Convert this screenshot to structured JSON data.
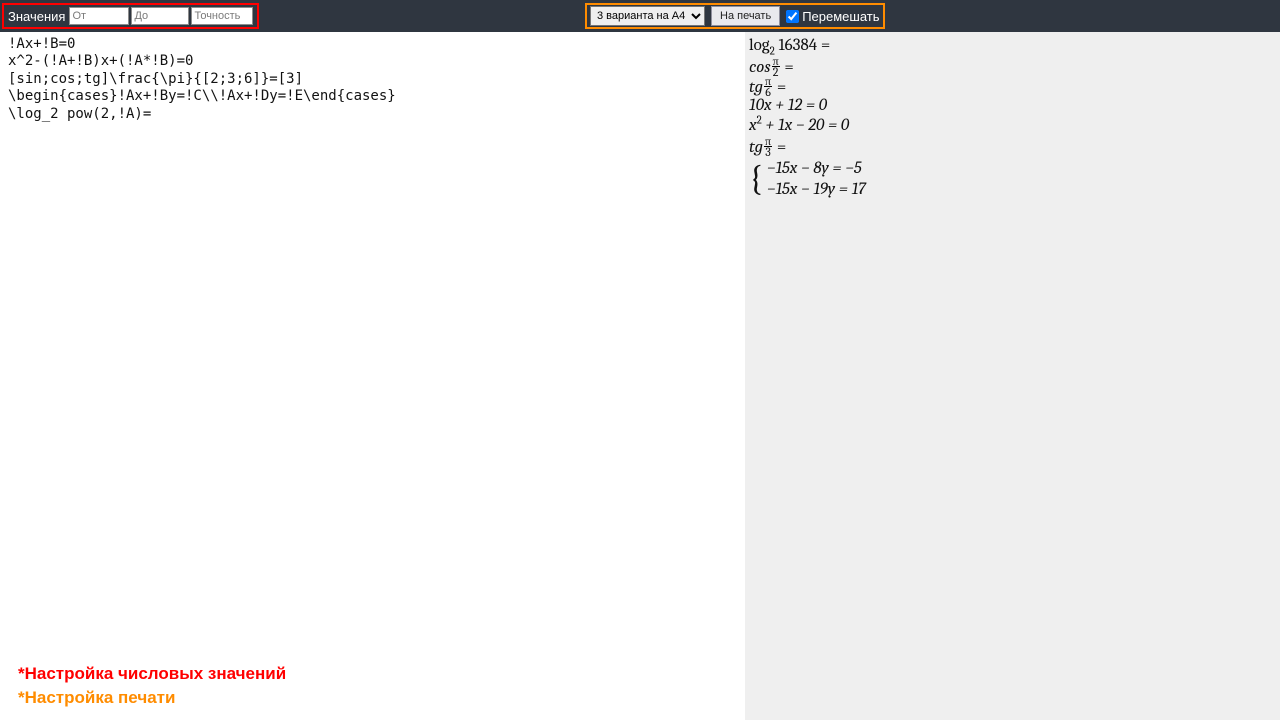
{
  "topbar": {
    "values_label": "Значения",
    "ot_placeholder": "От",
    "do_placeholder": "До",
    "prec_placeholder": "Точность",
    "variant_selected": "3 варианта на А4",
    "print_button": "На печать",
    "shuffle_label": "Перемешать",
    "shuffle_checked": "checked"
  },
  "editor": {
    "line1": "!Ax+!B=0",
    "line2": "x^2-(!A+!B)x+(!A*!B)=0",
    "line3": "[sin;cos;tg]\\frac{\\pi}{[2;3;6]}=[3]",
    "line4": "\\begin{cases}!Ax+!By=!C\\\\!Ax+!Dy=!E\\end{cases}",
    "line5": "\\log_2 pow(2,!A)="
  },
  "output": {
    "l1_a": "log",
    "l1_b": "2",
    "l1_c": " 16384 =",
    "l2_a": "cos",
    "l2_num": "π",
    "l2_den": "2",
    "l2_eq": " =",
    "l3_a": "tg",
    "l3_num": "π",
    "l3_den": "6",
    "l3_eq": " =",
    "l4": "10x + 12 = 0",
    "l5_a": "x",
    "l5_b": "2",
    "l5_c": " + 1x − 20 = 0",
    "l6_a": "tg",
    "l6_num": "π",
    "l6_den": "3",
    "l6_eq": " =",
    "l7": "−15x − 8y = −5",
    "l8": "−15x − 19y = 17"
  },
  "legend": {
    "l1": "*Настройка числовых значений",
    "l2": "*Настройка печати"
  }
}
